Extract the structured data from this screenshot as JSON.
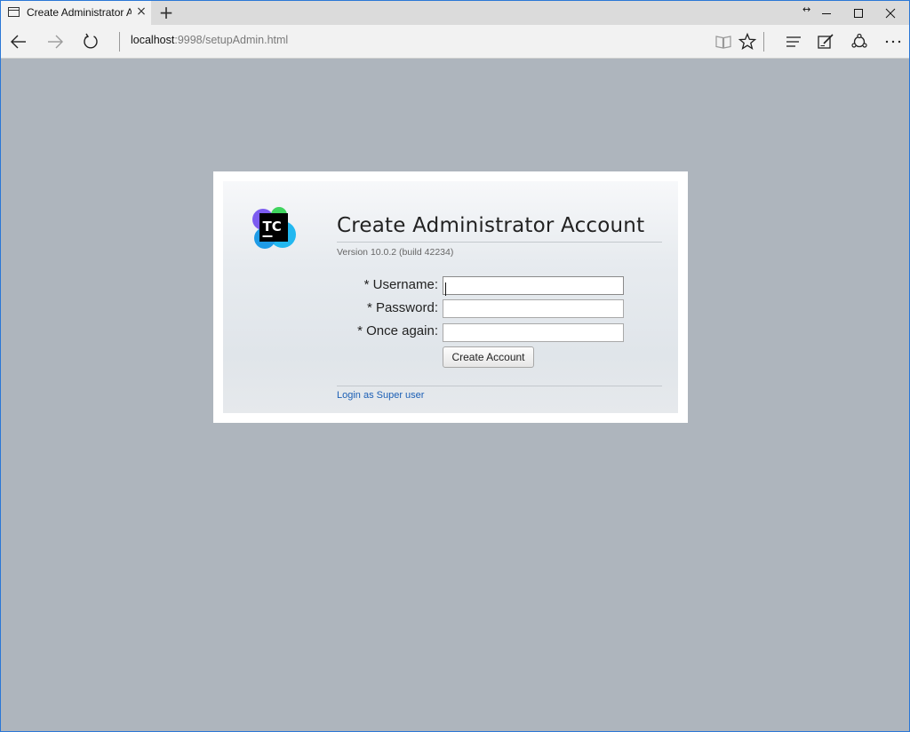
{
  "browser": {
    "tab_title": "Create Administrator Ac",
    "tab_close": "×",
    "new_tab": "+",
    "address_host": "localhost",
    "address_rest": ":9998/setupAdmin.html",
    "resize_glyph": "↔"
  },
  "page": {
    "logo_text": "TC",
    "title": "Create Administrator Account",
    "version": "Version 10.0.2 (build 42234)",
    "form": {
      "username_label": "* Username:",
      "password_label": "* Password:",
      "once_again_label": "* Once again:",
      "username_value": "",
      "password_value": "",
      "once_again_value": "",
      "submit_label": "Create Account"
    },
    "super_user_link": "Login as Super user"
  },
  "colors": {
    "accent": "#2b77d6",
    "page_background": "#aeb5bd",
    "link": "#1b5fb5"
  },
  "icons": [
    "page-icon",
    "close-icon",
    "plus-icon",
    "back-arrow-icon",
    "forward-arrow-icon",
    "refresh-icon",
    "reading-view-icon",
    "star-icon",
    "hub-icon",
    "web-note-icon",
    "share-icon",
    "more-icon",
    "minimize-icon",
    "maximize-icon",
    "window-close-icon"
  ]
}
